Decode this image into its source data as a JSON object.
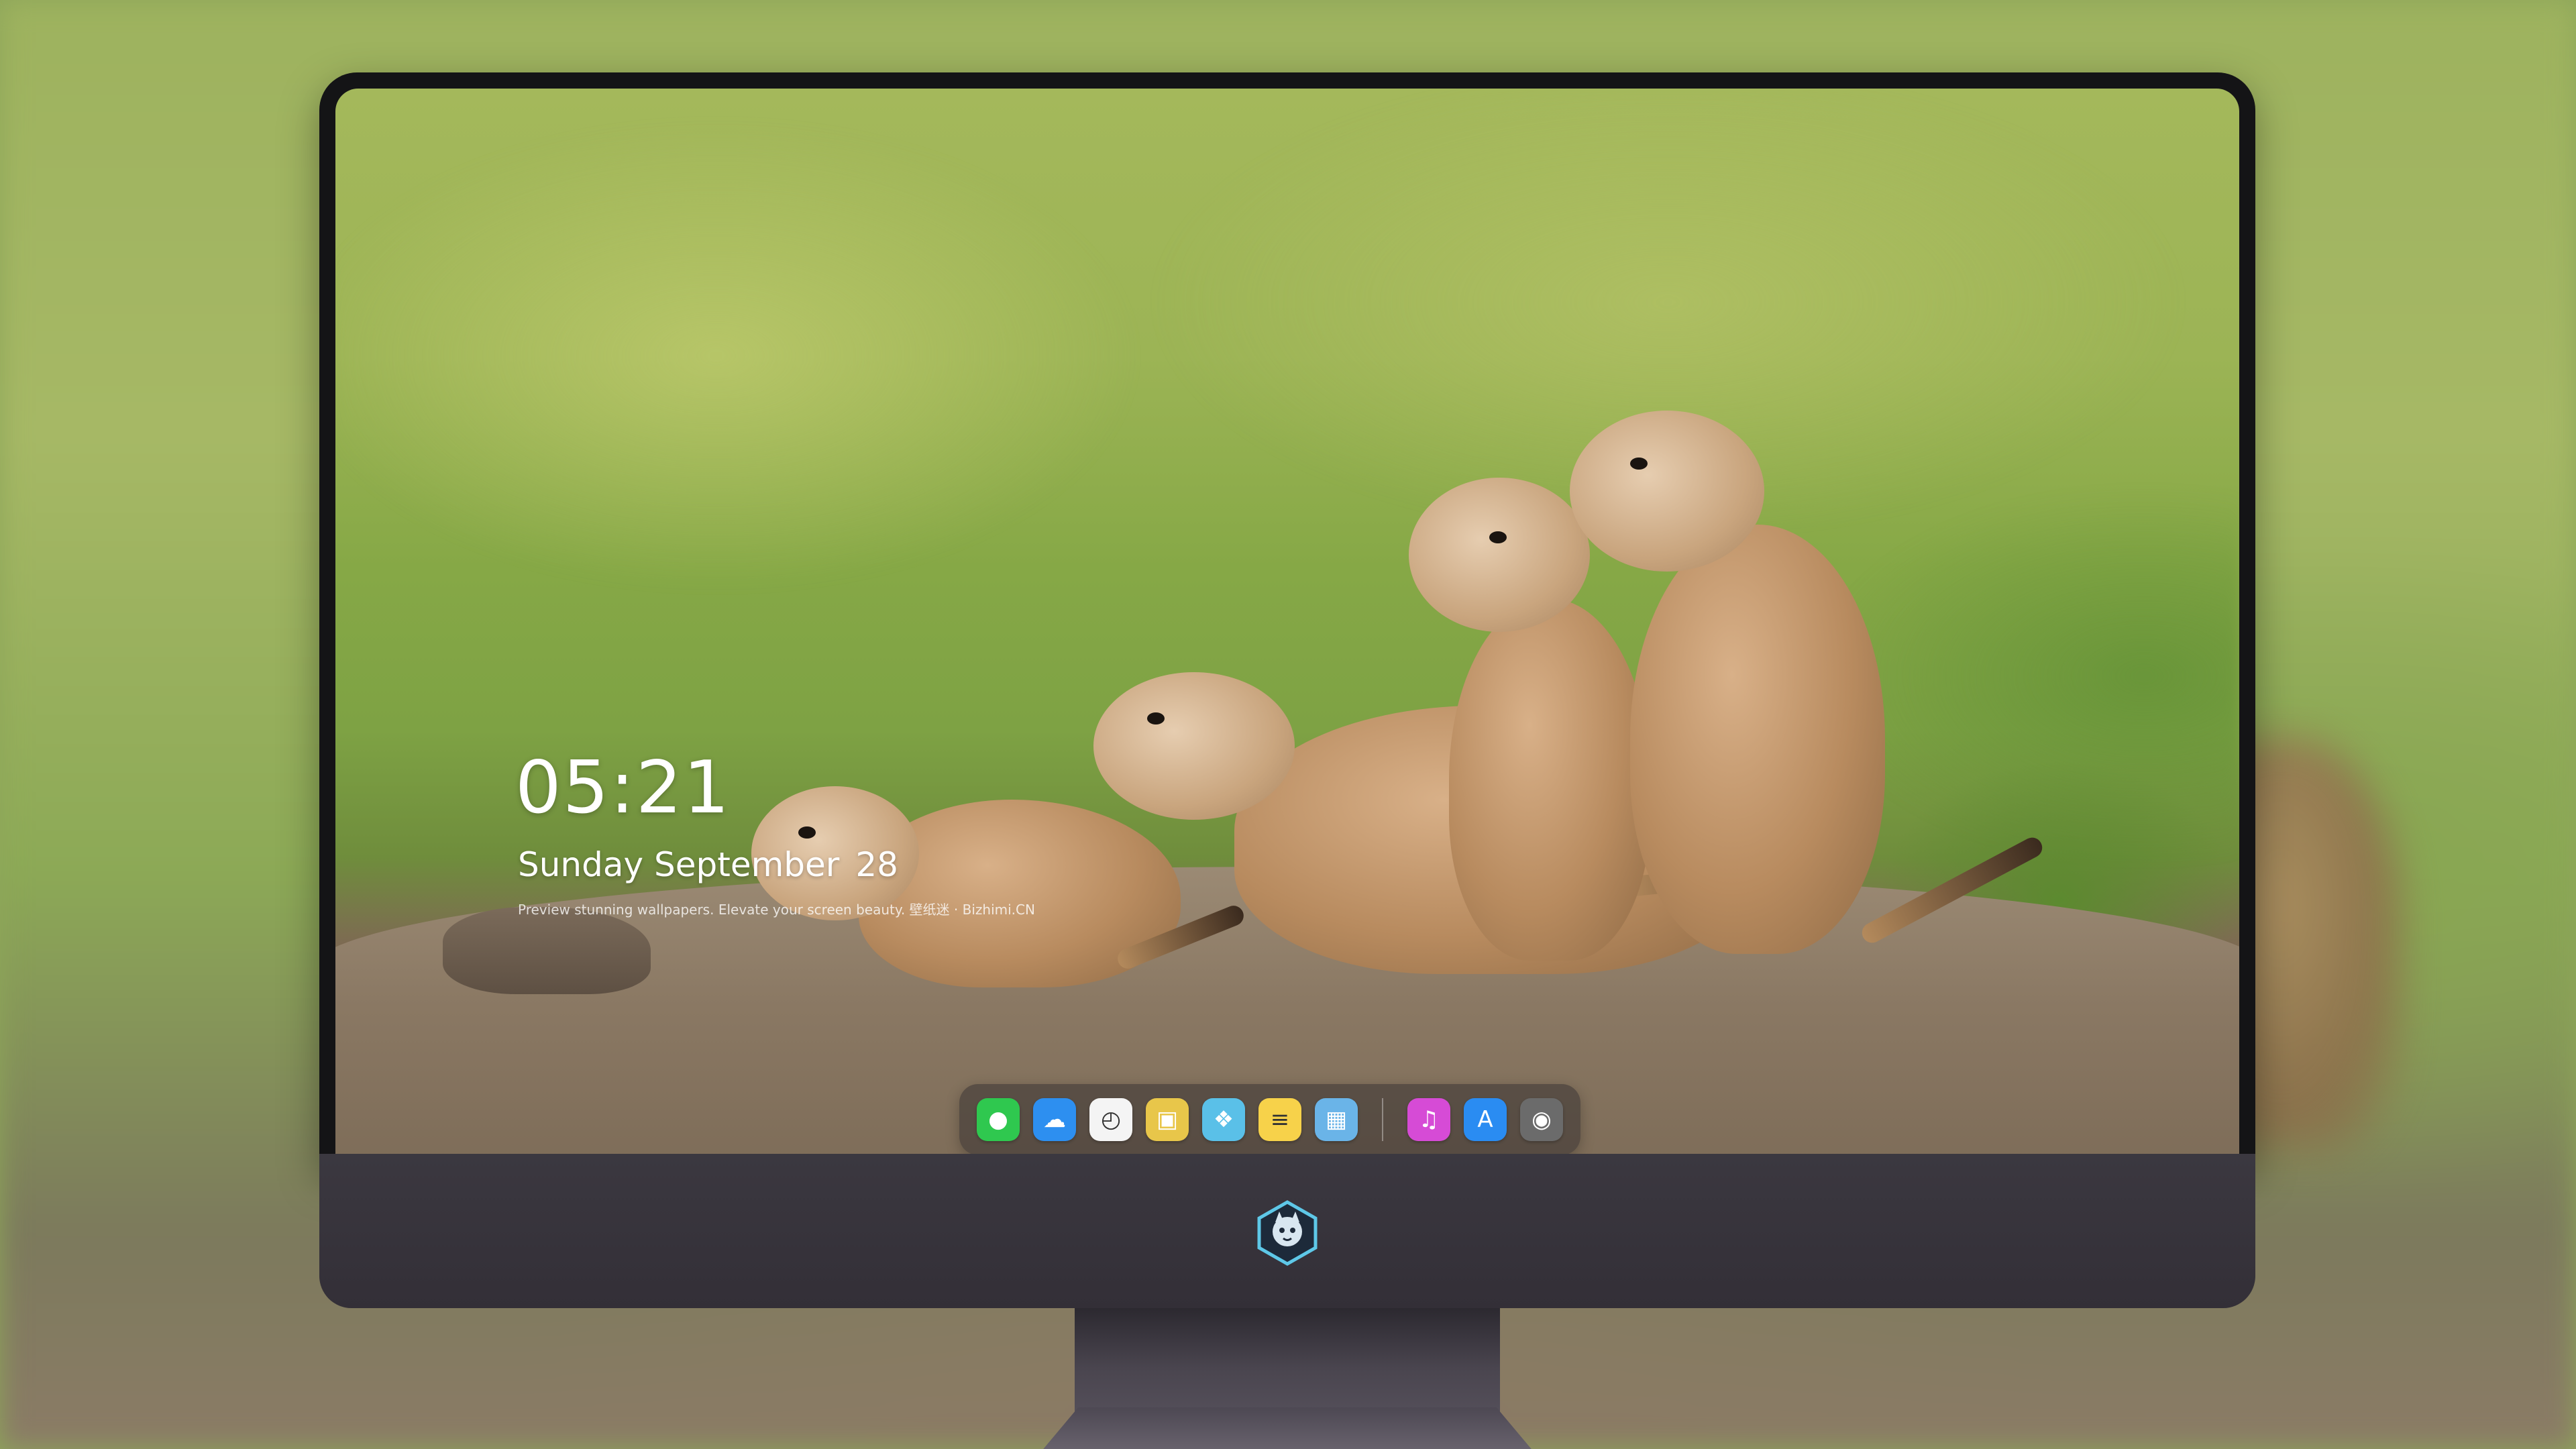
{
  "lock_screen": {
    "time": "05:21",
    "day": "Sunday",
    "month": "September",
    "date": "28",
    "tagline": "Preview stunning wallpapers. Elevate your screen beauty. 壁纸迷 · Bizhimi.CN"
  },
  "dock": {
    "apps": [
      {
        "name": "messages",
        "icon": "chat-bubble-icon",
        "color": "#2fc84f",
        "glyph": "●"
      },
      {
        "name": "weather",
        "icon": "cloud-icon",
        "color": "#2d8ff0",
        "glyph": "☁"
      },
      {
        "name": "clock",
        "icon": "clock-icon",
        "color": "#f4f4f4",
        "glyph": "◴"
      },
      {
        "name": "preview",
        "icon": "preview-icon",
        "color": "#e8c64a",
        "glyph": "▣"
      },
      {
        "name": "videos",
        "icon": "clapper-icon",
        "color": "#5ac0e8",
        "glyph": "❖"
      },
      {
        "name": "notes",
        "icon": "notes-icon",
        "color": "#f7d24a",
        "glyph": "≡"
      },
      {
        "name": "photo-booth",
        "icon": "photos-icon",
        "color": "#6ab4e8",
        "glyph": "▦"
      }
    ],
    "extra_apps": [
      {
        "name": "music",
        "icon": "music-note-icon",
        "color": "#d64bd6",
        "glyph": "♫"
      },
      {
        "name": "app-store",
        "icon": "app-store-icon",
        "color": "#2a8cf2",
        "glyph": "A"
      },
      {
        "name": "camera",
        "icon": "camera-icon",
        "color": "#6b6b6b",
        "glyph": "◉"
      }
    ]
  },
  "colors": {
    "accent_green": "#8faa55",
    "monitor_chin": "#38343c",
    "bezel": "#141416"
  }
}
